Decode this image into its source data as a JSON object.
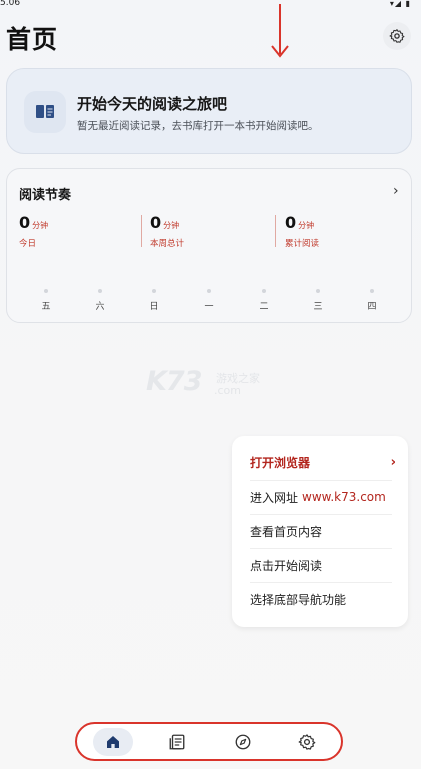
{
  "status": {
    "time": "5.06",
    "icons": "▾◢ ▮"
  },
  "header": {
    "title": "首页",
    "settings_icon": "gear-icon"
  },
  "start_card": {
    "title": "开始今天的阅读之旅吧",
    "subtitle": "暂无最近阅读记录，去书库打开一本书开始阅读吧。",
    "icon": "book-icon"
  },
  "rhythm": {
    "title": "阅读节奏",
    "stats": [
      {
        "value": "0",
        "unit": "分钟",
        "label": "今日"
      },
      {
        "value": "0",
        "unit": "分钟",
        "label": "本周总计"
      },
      {
        "value": "0",
        "unit": "分钟",
        "label": "累计阅读"
      }
    ],
    "days": [
      "五",
      "六",
      "日",
      "一",
      "二",
      "三",
      "四"
    ]
  },
  "watermark": {
    "brand": "K73",
    "text": "游戏之家",
    "suffix": ".com"
  },
  "guide": {
    "items": [
      {
        "label": "打开浏览器"
      },
      {
        "label": "进入网址",
        "url": "www.k73.com"
      },
      {
        "label": "查看首页内容"
      },
      {
        "label": "点击开始阅读"
      },
      {
        "label": "选择底部导航功能"
      }
    ]
  },
  "bottom_nav": {
    "items": [
      "home-icon",
      "library-icon",
      "compass-icon",
      "settings-icon"
    ],
    "active": "home-icon"
  },
  "colors": {
    "accent": "#b3261e",
    "annotation": "#d9342b",
    "card_bg": "#e9eef6"
  }
}
